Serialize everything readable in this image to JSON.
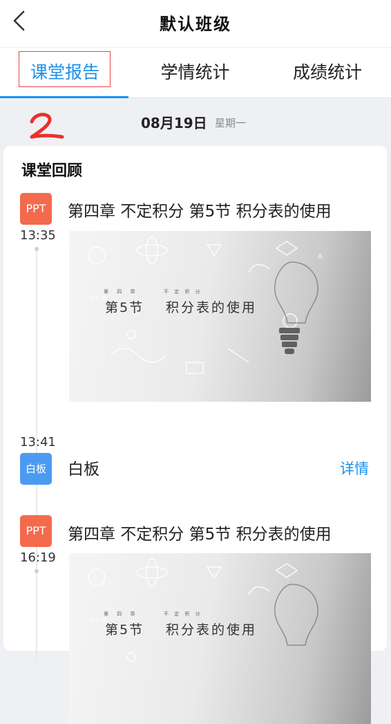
{
  "header": {
    "title": "默认班级"
  },
  "tabs": [
    {
      "label": "课堂报告",
      "active": true
    },
    {
      "label": "学情统计",
      "active": false
    },
    {
      "label": "成绩统计",
      "active": false
    }
  ],
  "annotation_mark": "2",
  "date": {
    "day": "08月19日",
    "weekday": "星期一"
  },
  "review": {
    "title": "课堂回顾",
    "items": [
      {
        "type_label": "PPT",
        "time": "13:35",
        "title": "第四章 不定积分 第5节 积分表的使用",
        "thumb": {
          "chapter": "第 四 章",
          "section": "第5节",
          "subject": "不 定 积 分",
          "name": "积分表的使用"
        }
      },
      {
        "type_label": "白板",
        "time": "13:41",
        "title": "白板",
        "detail_label": "详情"
      },
      {
        "type_label": "PPT",
        "time": "16:19",
        "title": "第四章 不定积分 第5节 积分表的使用",
        "thumb": {
          "chapter": "第 四 章",
          "section": "第5节",
          "subject": "不 定 积 分",
          "name": "积分表的使用"
        }
      }
    ]
  },
  "colors": {
    "accent": "#1a90ee",
    "ppt_badge": "#f46a4c",
    "whiteboard_badge": "#4c9bf2",
    "annotation": "#e8322a"
  }
}
